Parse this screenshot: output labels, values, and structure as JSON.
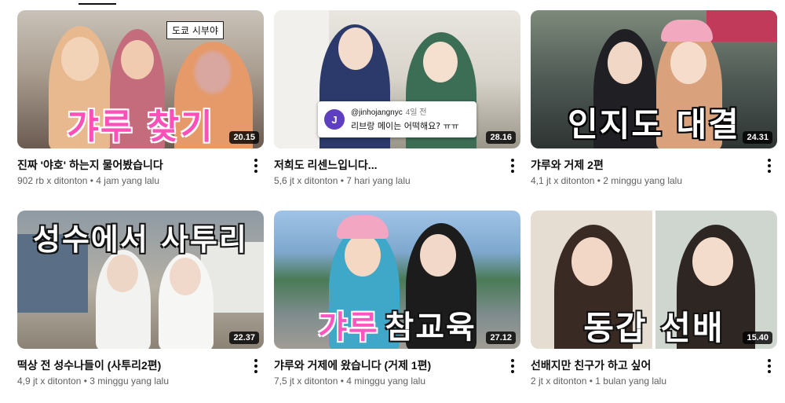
{
  "videos": [
    {
      "title": "진짜 '야호' 하는지 물어봤습니다",
      "views": "902 rb x ditonton",
      "ago": "4 jam yang lalu",
      "duration": "20.15",
      "thumb_text": "갸루 찾기",
      "thumb_tag": "도쿄 시부야"
    },
    {
      "title": "저희도 리센느입니다...",
      "views": "5,6 jt x ditonton",
      "ago": "7 hari yang lalu",
      "duration": "28.16",
      "comment": {
        "avatar_letter": "J",
        "user": "@jinhojangnyc",
        "ago": "4일 전",
        "text": "리브랑 메이는 어떡해요? ㅠㅠ"
      }
    },
    {
      "title": "갸루와 거제 2편",
      "views": "4,1 jt x ditonton",
      "ago": "2 minggu yang lalu",
      "duration": "24.31",
      "thumb_text": "인지도 대결"
    },
    {
      "title": "떡상 전 성수나들이 (사투리2편)",
      "views": "4,9 jt x ditonton",
      "ago": "3 minggu yang lalu",
      "duration": "22.37",
      "thumb_text": "성수에서 사투리"
    },
    {
      "title": "갸루와 거제에 왔습니다 (거제 1편)",
      "views": "7,5 jt x ditonton",
      "ago": "4 minggu yang lalu",
      "duration": "27.12",
      "thumb_text_a": "갸루",
      "thumb_text_b": "참교육"
    },
    {
      "title": "선배지만 친구가 하고 싶어",
      "views": "2 jt x ditonton",
      "ago": "1 bulan yang lalu",
      "duration": "15.40",
      "thumb_text": "동갑 선배"
    }
  ],
  "separator": "•",
  "icons": {
    "more": "more-vert-icon"
  }
}
